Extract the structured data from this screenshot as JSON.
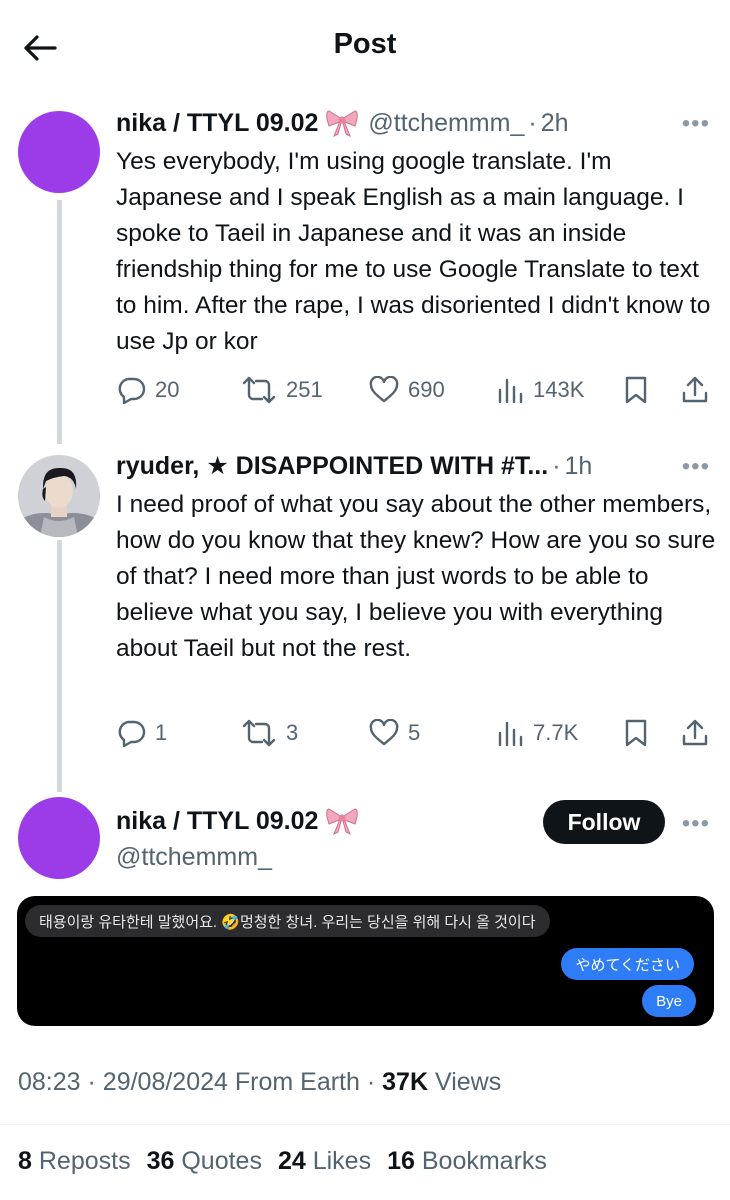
{
  "header": {
    "title": "Post"
  },
  "thread": [
    {
      "name": "nika / TTYL 09.02",
      "handle": "@ttchemmm_",
      "time": "2h",
      "text": "Yes everybody, I'm using google translate. I'm Japanese and I speak English as a main language. I spoke to Taeil in Japanese and it was an inside friendship thing for me to use Google Translate to text to him. After the rape, I was disoriented I didn't know to use Jp or kor",
      "replies": "20",
      "reposts": "251",
      "likes": "690",
      "views": "143K"
    },
    {
      "name": "ryuder, ★ DISAPPOINTED WITH #T...",
      "time": "1h",
      "text": "I need proof of what you say about the other members, how do you know that they knew? How are you so sure of that? I need more than just words to be able to believe what you say, I believe you with everything about Taeil but not the rest.",
      "replies": "1",
      "reposts": "3",
      "likes": "5",
      "views": "7.7K"
    }
  ],
  "main_post": {
    "name": "nika / TTYL 09.02",
    "handle": "@ttchemmm_",
    "follow_label": "Follow",
    "chat": {
      "incoming": "태용이랑 유타한테 말했어요. 🤣멍청한 창녀. 우리는 당신을 위해 다시 올 것이다",
      "outgoing_1": "やめてください",
      "outgoing_2": "Bye"
    },
    "time": "08:23",
    "date": "29/08/2024",
    "source": "From Earth",
    "views_count": "37K",
    "views_label": "Views"
  },
  "stats": {
    "reposts_count": "8",
    "reposts_label": "Reposts",
    "quotes_count": "36",
    "quotes_label": "Quotes",
    "likes_count": "24",
    "likes_label": "Likes",
    "bookmarks_count": "16",
    "bookmarks_label": "Bookmarks"
  },
  "colors": {
    "avatar": "#9c3ce8",
    "text_primary": "#0f1419",
    "text_secondary": "#536471",
    "bubble_outgoing": "#2e7cf6",
    "bubble_incoming": "#2c2c2e",
    "bow": "#f2a8bc"
  }
}
